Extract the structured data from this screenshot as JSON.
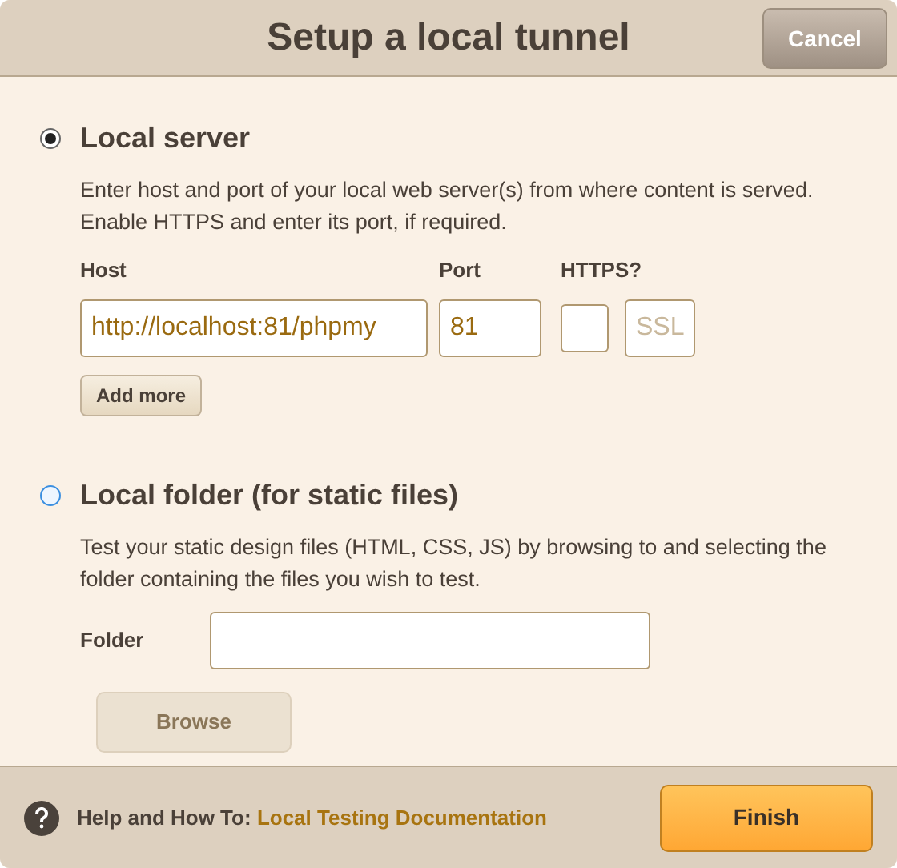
{
  "dialog": {
    "title": "Setup a local tunnel",
    "cancel_button": "Cancel"
  },
  "options": [
    {
      "kind": "server",
      "label": "Local server",
      "selected": true,
      "description": "Enter host and port of your local web server(s) from where content is served. Enable HTTPS and enter its port, if required.",
      "host": {
        "label": "Host",
        "value": "http://localhost:81/phpmy"
      },
      "port": {
        "label": "Port",
        "value": "81"
      },
      "https": {
        "label": "HTTPS?",
        "checked": false,
        "placeholder": "SSL"
      },
      "add_button": "Add more"
    },
    {
      "kind": "folder",
      "label": "Local folder (for static files)",
      "selected": false,
      "description": "Test your static design files (HTML, CSS, JS) by browsing to and selecting the folder containing the files you wish to test.",
      "folder": {
        "label": "Folder"
      },
      "browse_button": {
        "label": "Browse",
        "disabled": true
      }
    }
  ],
  "footer": {
    "help_label": "Help and How To:",
    "help_link": "Local Testing Documentation",
    "finish_button": "Finish"
  }
}
